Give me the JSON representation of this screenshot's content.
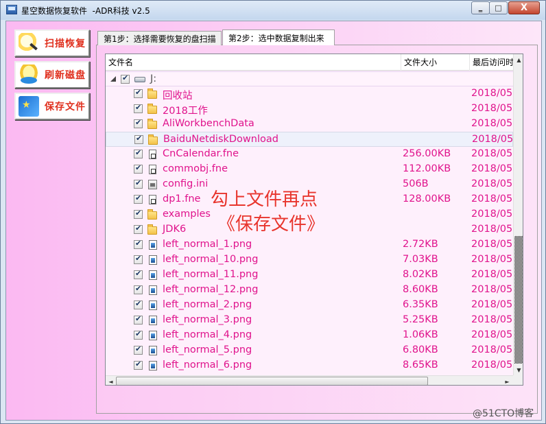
{
  "window": {
    "title": "星空数据恢复软件  -ADR科技 v2.5",
    "controls": {
      "min": "‗",
      "max": "□",
      "close": "X"
    }
  },
  "sidebar": {
    "buttons": [
      {
        "label": "扫描恢复",
        "icon": "magnifier-icon"
      },
      {
        "label": "刷新磁盘",
        "icon": "refresh-disk-icon"
      },
      {
        "label": "保存文件",
        "icon": "save-file-icon"
      }
    ]
  },
  "tabs": [
    {
      "label": "第1步：选择需要恢复的盘扫描",
      "active": false
    },
    {
      "label": "第2步：选中数据复制出来",
      "active": true
    }
  ],
  "list": {
    "columns": [
      "文件名",
      "文件大小",
      "最后访问时间"
    ],
    "root": {
      "name": "J:",
      "checked": true
    },
    "rows": [
      {
        "name": "回收站",
        "size": "",
        "time": "2018/05",
        "type": "folder"
      },
      {
        "name": "2018工作",
        "size": "",
        "time": "2018/05",
        "type": "folder"
      },
      {
        "name": "AliWorkbenchData",
        "size": "",
        "time": "2018/05",
        "type": "folder"
      },
      {
        "name": "BaiduNetdiskDownload",
        "size": "",
        "time": "2018/05",
        "type": "folder"
      },
      {
        "name": "CnCalendar.fne",
        "size": "256.00KB",
        "time": "2018/05",
        "type": "doc"
      },
      {
        "name": "commobj.fne",
        "size": "112.00KB",
        "time": "2018/05",
        "type": "doc"
      },
      {
        "name": "config.ini",
        "size": "506B",
        "time": "2018/05",
        "type": "ini"
      },
      {
        "name": "dp1.fne",
        "size": "128.00KB",
        "time": "2018/05",
        "type": "doc"
      },
      {
        "name": "examples",
        "size": "",
        "time": "2018/05",
        "type": "folder"
      },
      {
        "name": "JDK6",
        "size": "",
        "time": "2018/05",
        "type": "folder"
      },
      {
        "name": "left_normal_1.png",
        "size": "2.72KB",
        "time": "2018/05",
        "type": "png"
      },
      {
        "name": "left_normal_10.png",
        "size": "7.03KB",
        "time": "2018/05",
        "type": "png"
      },
      {
        "name": "left_normal_11.png",
        "size": "8.02KB",
        "time": "2018/05",
        "type": "png"
      },
      {
        "name": "left_normal_12.png",
        "size": "8.60KB",
        "time": "2018/05",
        "type": "png"
      },
      {
        "name": "left_normal_2.png",
        "size": "6.35KB",
        "time": "2018/05",
        "type": "png"
      },
      {
        "name": "left_normal_3.png",
        "size": "5.25KB",
        "time": "2018/05",
        "type": "png"
      },
      {
        "name": "left_normal_4.png",
        "size": "1.06KB",
        "time": "2018/05",
        "type": "png"
      },
      {
        "name": "left_normal_5.png",
        "size": "6.80KB",
        "time": "2018/05",
        "type": "png"
      },
      {
        "name": "left_normal_6.png",
        "size": "8.65KB",
        "time": "2018/05",
        "type": "png"
      }
    ]
  },
  "annotation": {
    "line1": "勾上文件再点",
    "line2": "《保存文件》"
  },
  "watermark": "@51CTO博客"
}
